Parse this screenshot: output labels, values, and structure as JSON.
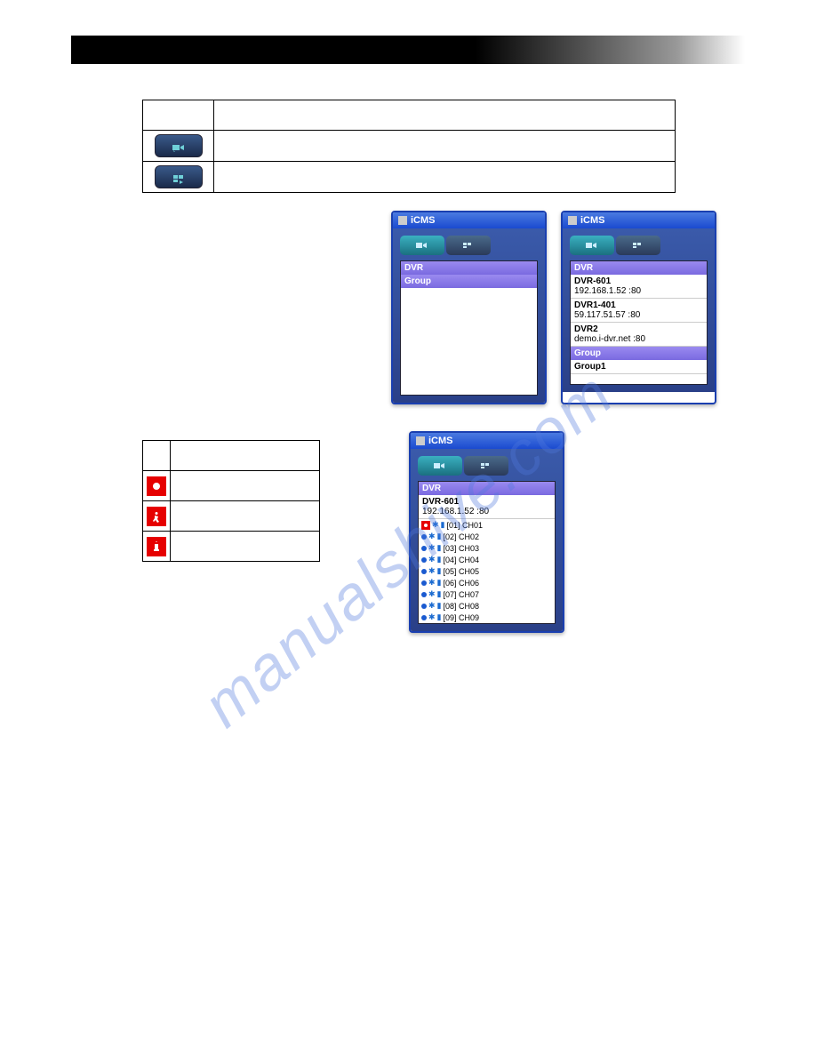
{
  "watermark": "manualshive.com",
  "iconTable": {
    "rows": [
      {
        "iconName": "camera-icon",
        "desc": ""
      },
      {
        "iconName": "layout-icon",
        "desc": ""
      }
    ]
  },
  "smallTable": {
    "rows": [
      {
        "iconName": "record-icon",
        "label": ""
      },
      {
        "iconName": "motion-icon",
        "label": ""
      },
      {
        "iconName": "sensor-icon",
        "label": ""
      }
    ]
  },
  "panel1": {
    "title": "iCMS",
    "headers": {
      "dvr": "DVR",
      "group": "Group"
    }
  },
  "panel2": {
    "title": "iCMS",
    "headers": {
      "dvr": "DVR",
      "group": "Group"
    },
    "dvrs": [
      {
        "name": "DVR-601",
        "addr": "192.168.1.52 :80"
      },
      {
        "name": "DVR1-401",
        "addr": "59.117.51.57 :80"
      },
      {
        "name": "DVR2",
        "addr": "demo.i-dvr.net :80"
      }
    ],
    "groups": [
      "Group1"
    ]
  },
  "panel3": {
    "title": "iCMS",
    "headers": {
      "dvr": "DVR"
    },
    "dvr": {
      "name": "DVR-601",
      "addr": "192.168.1.52 :80"
    },
    "channels": [
      {
        "rec": true,
        "label": "[01] CH01"
      },
      {
        "rec": false,
        "label": "[02] CH02"
      },
      {
        "rec": false,
        "label": "[03] CH03"
      },
      {
        "rec": false,
        "label": "[04] CH04"
      },
      {
        "rec": false,
        "label": "[05] CH05"
      },
      {
        "rec": false,
        "label": "[06] CH06"
      },
      {
        "rec": false,
        "label": "[07] CH07"
      },
      {
        "rec": false,
        "label": "[08] CH08"
      },
      {
        "rec": false,
        "label": "[09] CH09"
      }
    ]
  }
}
